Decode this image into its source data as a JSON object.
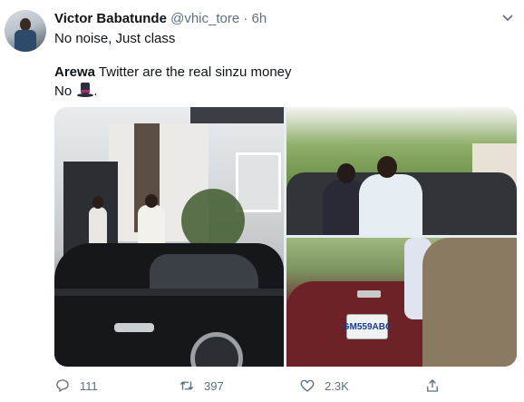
{
  "tweet": {
    "author_name": "Victor Babatunde",
    "handle": "@vhic_tore",
    "separator": "·",
    "time": "6h",
    "caption": "No noise, Just class",
    "quote_name": "Arewa",
    "quote_text": " Twitter are the real sinzu money",
    "quote_line2": "No ",
    "quote_line2_end": ".",
    "emoji": "top-hat-emoji"
  },
  "media": {
    "plate_text": "GM559ABC"
  },
  "actions": {
    "reply_count": "111",
    "retweet_count": "397",
    "like_count": "2.3K",
    "icons": [
      "reply-icon",
      "retweet-icon",
      "like-icon",
      "share-icon"
    ]
  },
  "colors": {
    "text": "#0f1419",
    "muted": "#5b7083"
  }
}
